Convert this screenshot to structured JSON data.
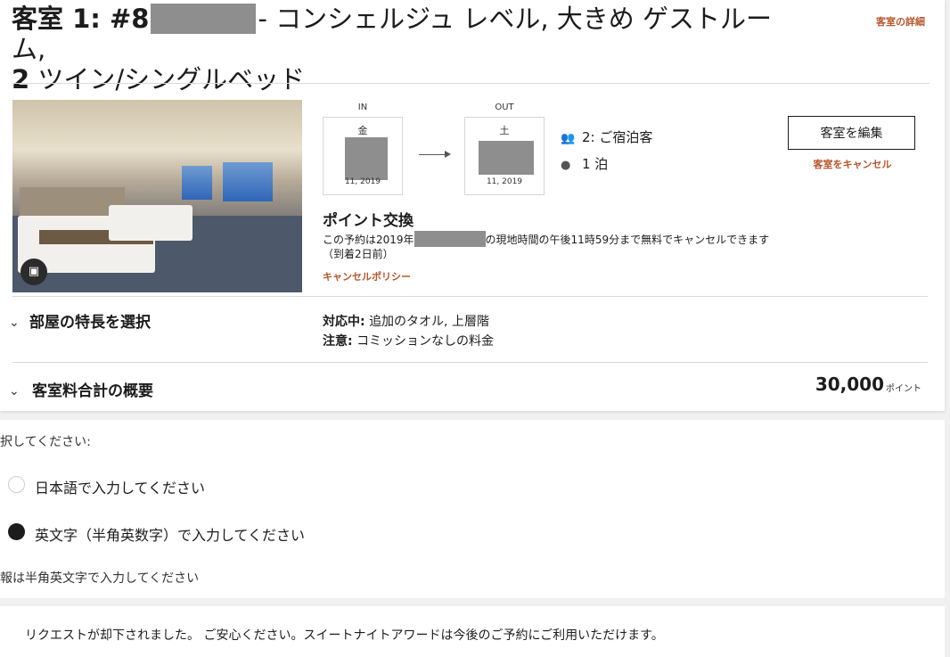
{
  "header": {
    "title_prefix": "客室 1: #",
    "title_digit": "8",
    "title_main": "- コンシェルジュ レベル, 大きめ ゲストルーム,",
    "title_count": "2",
    "title_rest": " ツイン/シングルベッド",
    "detail_link": "客室の詳細"
  },
  "dates": {
    "in_label": "IN",
    "out_label": "OUT",
    "checkin_dow": "金",
    "checkin_date": "11, 2019",
    "checkout_dow": "土",
    "checkout_date": "11, 2019"
  },
  "stay": {
    "guests": "2: ご宿泊客",
    "nights": "1 泊"
  },
  "actions": {
    "edit_room": "客室を編集",
    "cancel_room": "客室をキャンセル"
  },
  "rate": {
    "title": "ポイント交換",
    "cancel_prefix": "この予約は2019年",
    "cancel_suffix": "の現地時間の午後11時59分まで無料でキャンセルできます（到着2日前）",
    "policy_link": "キャンセルポリシー"
  },
  "features": {
    "section_title": "部屋の特長を選択",
    "accommodating_label": "対応中:",
    "accommodating_value": "追加のタオル, 上層階",
    "note_label": "注意:",
    "note_value": "コミッションなしの料金"
  },
  "summary": {
    "section_title": "客室料合計の概要",
    "total": "30,000",
    "unit": "ポイント"
  },
  "language_form": {
    "prompt": "選択してください:",
    "option_japanese": "日本語で入力してください",
    "option_english": "英文字（半角英数字）で入力してください",
    "selected": "english",
    "hint": "情報は半角英文字で入力してください"
  },
  "notice": {
    "text": "リクエストが却下されました。 ご安心ください。スイートナイトアワードは今後のご予約にご利用いただけます。"
  },
  "colors": {
    "accent": "#b5562c",
    "redaction": "#8e8e8e"
  }
}
